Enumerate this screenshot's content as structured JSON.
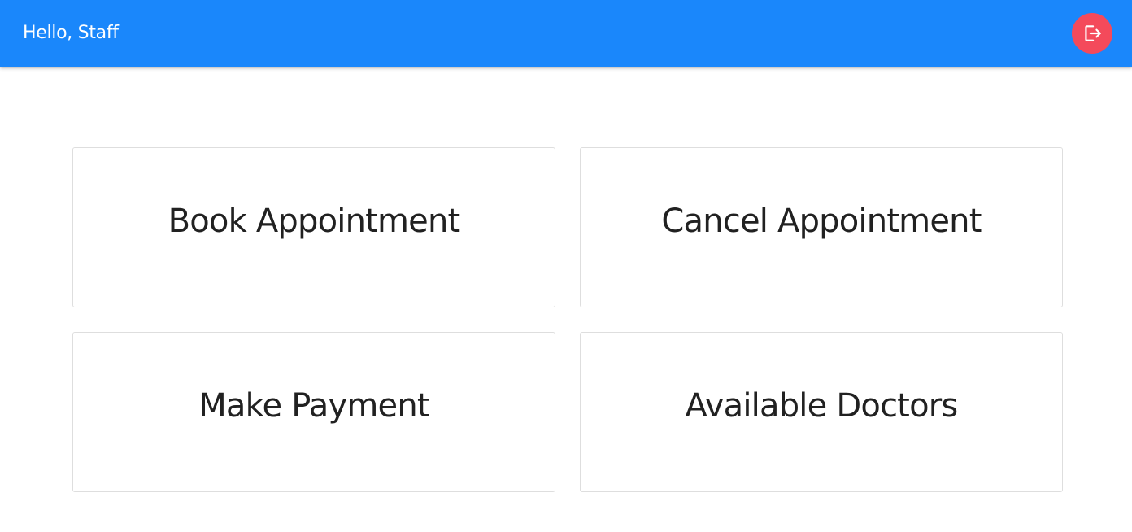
{
  "header": {
    "greeting": "Hello, Staff",
    "logout_icon": "logout-icon",
    "background_color": "#1a87fb",
    "logout_button_color": "#f44a5b"
  },
  "cards": [
    {
      "label": "Book Appointment"
    },
    {
      "label": "Cancel Appointment"
    },
    {
      "label": "Make Payment"
    },
    {
      "label": "Available Doctors"
    }
  ]
}
